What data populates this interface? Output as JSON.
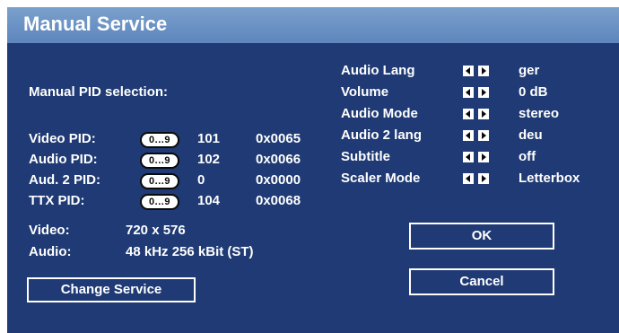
{
  "window": {
    "title": "Manual Service"
  },
  "pid_section": {
    "heading": "Manual PID selection:",
    "rows": [
      {
        "label": "Video PID:",
        "entry": "0...9",
        "dec": "101",
        "hex": "0x0065"
      },
      {
        "label": "Audio PID:",
        "entry": "0...9",
        "dec": "102",
        "hex": "0x0066"
      },
      {
        "label": "Aud. 2 PID:",
        "entry": "0...9",
        "dec": "0",
        "hex": "0x0000"
      },
      {
        "label": "TTX PID:",
        "entry": "0...9",
        "dec": "104",
        "hex": "0x0068"
      }
    ]
  },
  "info": {
    "video_label": "Video:",
    "video_value": "720 x 576",
    "audio_label": "Audio:",
    "audio_value": "48 kHz 256 kBit (ST)"
  },
  "settings": [
    {
      "label": "Audio Lang",
      "value": "ger"
    },
    {
      "label": "Volume",
      "value": "0 dB"
    },
    {
      "label": "Audio Mode",
      "value": "stereo"
    },
    {
      "label": "Audio 2 lang",
      "value": "deu"
    },
    {
      "label": "Subtitle",
      "value": "off"
    },
    {
      "label": "Scaler Mode",
      "value": "Letterbox"
    }
  ],
  "buttons": {
    "change_service": "Change Service",
    "ok": "OK",
    "cancel": "Cancel"
  },
  "colors": {
    "background": "#1f3a74",
    "title_bar": "#6b92c4",
    "text": "#ffffff"
  },
  "icons": {
    "left_arrow": "left-arrow-icon",
    "right_arrow": "right-arrow-icon"
  }
}
